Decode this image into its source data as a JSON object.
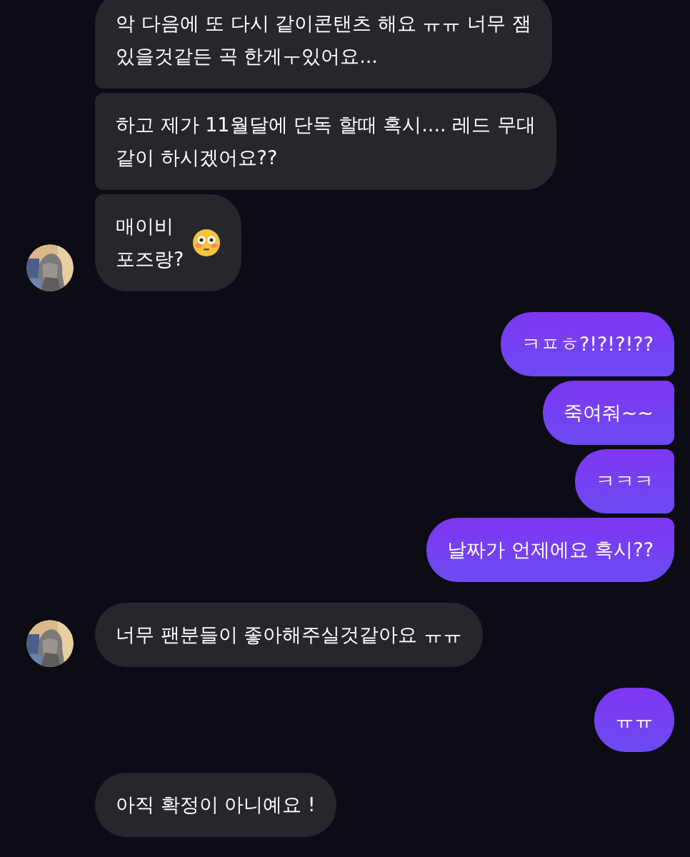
{
  "messages": [
    {
      "kind": "incoming",
      "avatar": false,
      "text": "악 다음에 또 다시 같이콘탠츠 해요 ㅠㅠ 너무 잼\n있을것같든 곡 한게ㅜ있어요..."
    },
    {
      "kind": "incoming",
      "avatar": false,
      "text": "하고 제가 11월달에 단독 할때 혹시.... 레드 무대\n같이 하시겠어요??"
    },
    {
      "kind": "incoming",
      "avatar": true,
      "text": "매이비\n포즈랑?",
      "emoji": true
    },
    {
      "kind": "outgoing",
      "text": "ㅋㅍㅎ?!?!?!??"
    },
    {
      "kind": "outgoing",
      "text": "죽여줘~~"
    },
    {
      "kind": "outgoing",
      "text": "ㅋㅋㅋ"
    },
    {
      "kind": "outgoing",
      "text": "날짜가 언제에요 혹시??"
    },
    {
      "kind": "incoming",
      "avatar": true,
      "text": "너무 팬분들이 좋아해주실것같아요 ㅠㅠ"
    },
    {
      "kind": "outgoing",
      "text": "ㅠㅠ"
    },
    {
      "kind": "incoming",
      "avatar": false,
      "text": "아직 확정이 아니예요 !"
    }
  ]
}
